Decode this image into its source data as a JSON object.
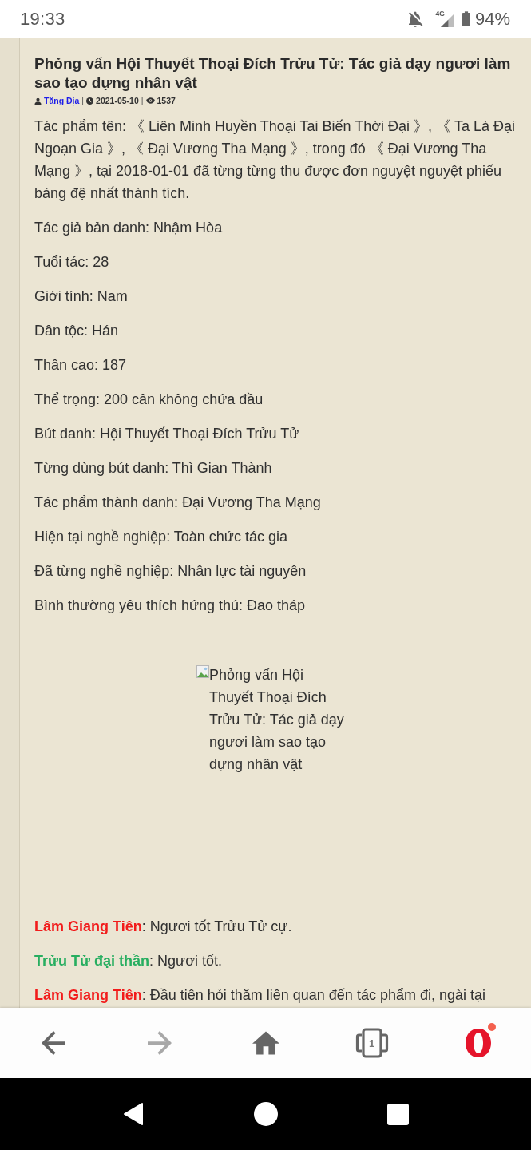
{
  "status_bar": {
    "time": "19:33",
    "icons": [
      {
        "kind": "notifications_off"
      },
      {
        "kind": "signal",
        "label": "4G"
      },
      {
        "kind": "battery"
      }
    ],
    "battery": "94%"
  },
  "article": {
    "title": "Phỏng vấn Hội Thuyết Thoại Đích Trửu Tử: Tác giả dạy ngươi làm sao tạo dựng nhân vật",
    "meta": [
      {
        "kind": "author",
        "text": "Tăng Địa",
        "separator": "|"
      },
      {
        "kind": "date",
        "text": "2021-05-10",
        "separator": "|"
      },
      {
        "kind": "views",
        "text": "1537"
      }
    ],
    "intro": "Tác phẩm tên: 《 Liên Minh Huyền Thoại Tai Biến Thời Đại 》, 《 Ta Là Đại Ngoạn Gia 》, 《 Đại Vương Tha Mạng 》, trong đó 《 Đại Vương Tha Mạng 》, tại 2018-01-01 đã từng từng thu được đơn nguyệt nguyệt phiếu bảng đệ nhất thành tích.",
    "facts": [
      "Tác giả bản danh: Nhậm Hòa",
      "Tuổi tác: 28",
      "Giới tính: Nam",
      "Dân tộc: Hán",
      "Thân cao: 187",
      "Thể trọng: 200 cân không chứa đầu",
      "Bút danh: Hội Thuyết Thoại Đích Trửu Tử",
      "Từng dùng bút danh: Thì Gian Thành",
      "Tác phẩm thành danh: Đại Vương Tha Mạng",
      "Hiện tại nghề nghiệp: Toàn chức tác gia",
      "Đã từng nghề nghiệp: Nhân lực tài nguyên",
      "Bình thường yêu thích hứng thú: Đao tháp"
    ],
    "image": {
      "alt": "Phỏng vấn Hội Thuyết Thoại Đích Trửu Tử: Tác giả dạy ngươi làm sao tạo dựng nhân vật"
    },
    "dialogue": [
      {
        "speaker": "Lâm Giang Tiên",
        "color": "#f21b1b",
        "text": ": Ngươi tốt Trửu Tử cự."
      },
      {
        "speaker": "Trửu Tử đại thần",
        "color": "#27ae60",
        "text": ": Ngươi tốt."
      },
      {
        "speaker": "Lâm Giang Tiên",
        "color": "#f21b1b",
        "text": ": Đầu tiên hỏi thăm liên quan đến tác phẩm đi, ngài tại"
      }
    ]
  },
  "browser_toolbar": [
    {
      "kind": "back",
      "disabled": false,
      "notification": false
    },
    {
      "kind": "forward",
      "disabled": true,
      "notification": false
    },
    {
      "kind": "home",
      "disabled": false,
      "notification": false
    },
    {
      "kind": "tabs",
      "count": "1",
      "disabled": false,
      "notification": false
    },
    {
      "kind": "opera",
      "disabled": false,
      "notification": true
    }
  ],
  "system_nav": [
    {
      "kind": "back"
    },
    {
      "kind": "home"
    },
    {
      "kind": "recents"
    }
  ]
}
